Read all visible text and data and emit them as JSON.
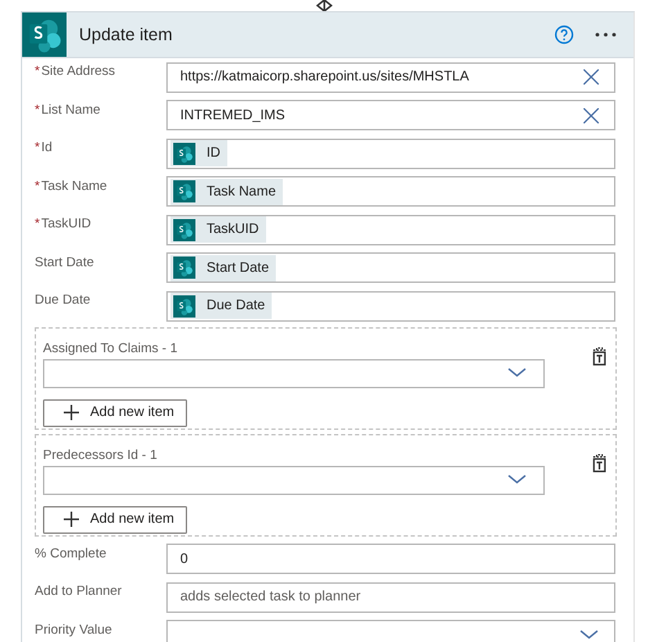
{
  "card": {
    "title": "Update item"
  },
  "fields": [
    {
      "kind": "text",
      "marker": "*",
      "label": "Site Address",
      "value": "https://katmaicorp.sharepoint.us/sites/MHSTLA"
    },
    {
      "kind": "text",
      "marker": "*",
      "label": "List Name",
      "value": "INTREMED_IMS"
    },
    {
      "kind": "token",
      "marker": "*",
      "label": "Id",
      "value": "ID"
    },
    {
      "kind": "token",
      "marker": "*",
      "label": "Task Name",
      "value": "Task Name"
    },
    {
      "kind": "token",
      "marker": "*",
      "label": "TaskUID",
      "value": "TaskUID"
    },
    {
      "kind": "token",
      "label": "Start Date",
      "value": "Start Date"
    },
    {
      "kind": "token",
      "label": "Due Date",
      "value": "Due Date"
    },
    {
      "kind": "array",
      "label": "Assigned To Claims - 1",
      "button": "Add new item"
    },
    {
      "kind": "array",
      "label": "Predecessors Id - 1",
      "button": "Add new item"
    },
    {
      "kind": "plain",
      "label": "% Complete",
      "value": "0"
    },
    {
      "kind": "plain",
      "label": "Add to Planner",
      "placeholder": "adds selected task to planner"
    },
    {
      "kind": "dropdown",
      "label": "Priority Value"
    }
  ]
}
